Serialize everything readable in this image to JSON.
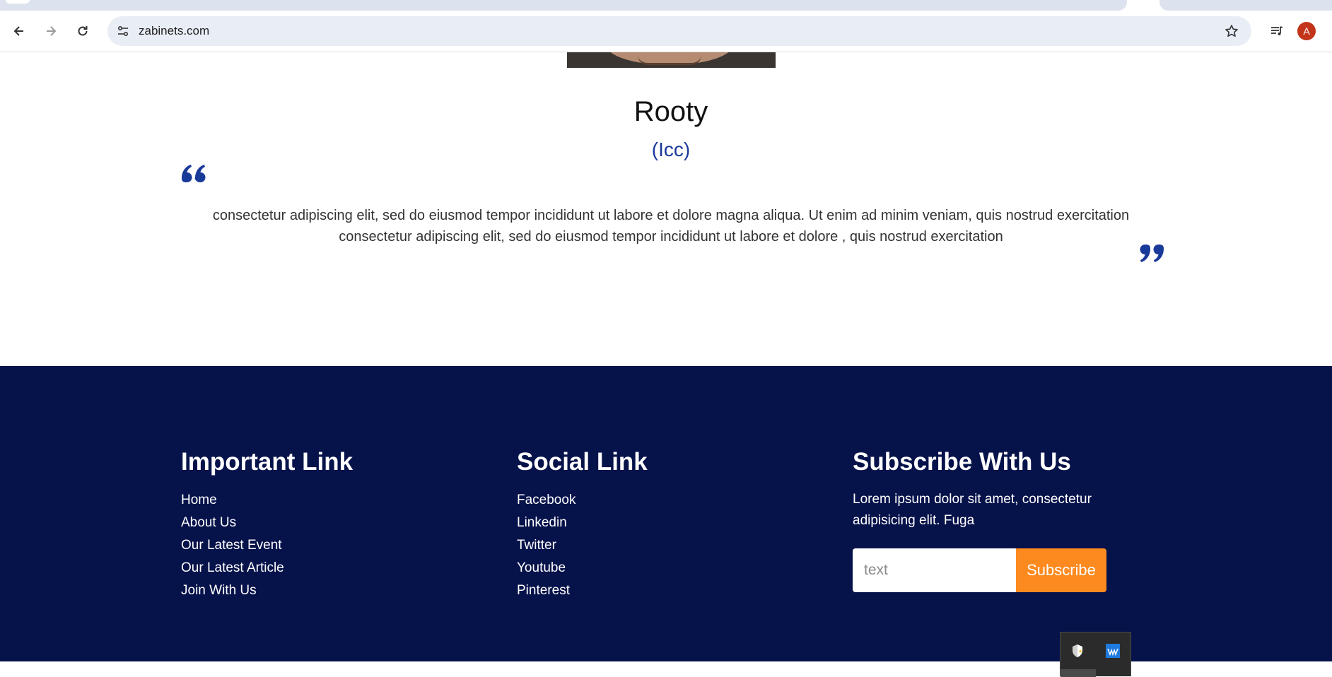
{
  "browser": {
    "url": "zabinets.com",
    "avatar_letter": "A",
    "icons": [
      "back-arrow-icon",
      "forward-arrow-icon",
      "reload-icon",
      "site-info-icon",
      "bookmark-star-icon",
      "media-control-icon"
    ]
  },
  "testimonial": {
    "name": "Rooty",
    "role": "(Icc)",
    "quote": "consectetur adipiscing elit, sed do eiusmod tempor incididunt ut labore et dolore magna aliqua. Ut enim ad minim veniam, quis nostrud exercitation consectetur adipiscing elit, sed do eiusmod tempor incididunt ut labore et dolore , quis nostrud exercitation",
    "accent_color": "#1a3a9a"
  },
  "footer": {
    "background": "#06124a",
    "important": {
      "heading": "Important Link",
      "links": [
        "Home",
        "About Us",
        "Our Latest Event",
        "Our Latest Article",
        "Join With Us"
      ]
    },
    "social": {
      "heading": "Social Link",
      "links": [
        "Facebook",
        "Linkedin",
        "Twitter",
        "Youtube",
        "Pinterest"
      ]
    },
    "subscribe": {
      "heading": "Subscribe With Us",
      "text": "Lorem ipsum dolor sit amet, consectetur adipisicing elit. Fuga",
      "input_placeholder": "text",
      "button_label": "Subscribe",
      "button_color": "#fd8a1f"
    }
  },
  "tray": {
    "icons": [
      "security-shield-icon",
      "audio-app-icon"
    ]
  }
}
